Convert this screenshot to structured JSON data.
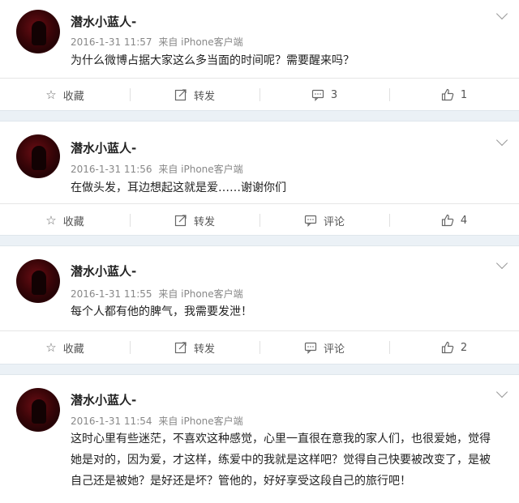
{
  "posts": [
    {
      "name": "潜水小蓝人-",
      "time": "2016-1-31 11:57",
      "source": "来自 iPhone客户端",
      "content": "为什么微博占据大家这么多当面的时间呢？需要醒来吗？",
      "actions": {
        "fav": "收藏",
        "repost": "转发",
        "comment": "3",
        "like": "1"
      }
    },
    {
      "name": "潜水小蓝人-",
      "time": "2016-1-31 11:56",
      "source": "来自 iPhone客户端",
      "content": "在做头发，耳边想起这就是爱……谢谢你们",
      "actions": {
        "fav": "收藏",
        "repost": "转发",
        "comment": "评论",
        "like": "4"
      }
    },
    {
      "name": "潜水小蓝人-",
      "time": "2016-1-31 11:55",
      "source": "来自 iPhone客户端",
      "content": "每个人都有他的脾气，我需要发泄！",
      "actions": {
        "fav": "收藏",
        "repost": "转发",
        "comment": "评论",
        "like": "2"
      }
    },
    {
      "name": "潜水小蓝人-",
      "time": "2016-1-31 11:54",
      "source": "来自 iPhone客户端",
      "content": "这时心里有些迷茫，不喜欢这种感觉，心里一直很在意我的家人们，也很爱她，觉得她是对的，因为爱，才这样，练爱中的我就是这样吧？觉得自己快要被改变了，是被自己还是被她？是好还是坏？管他的，好好享受这段自己的旅行吧！"
    }
  ]
}
